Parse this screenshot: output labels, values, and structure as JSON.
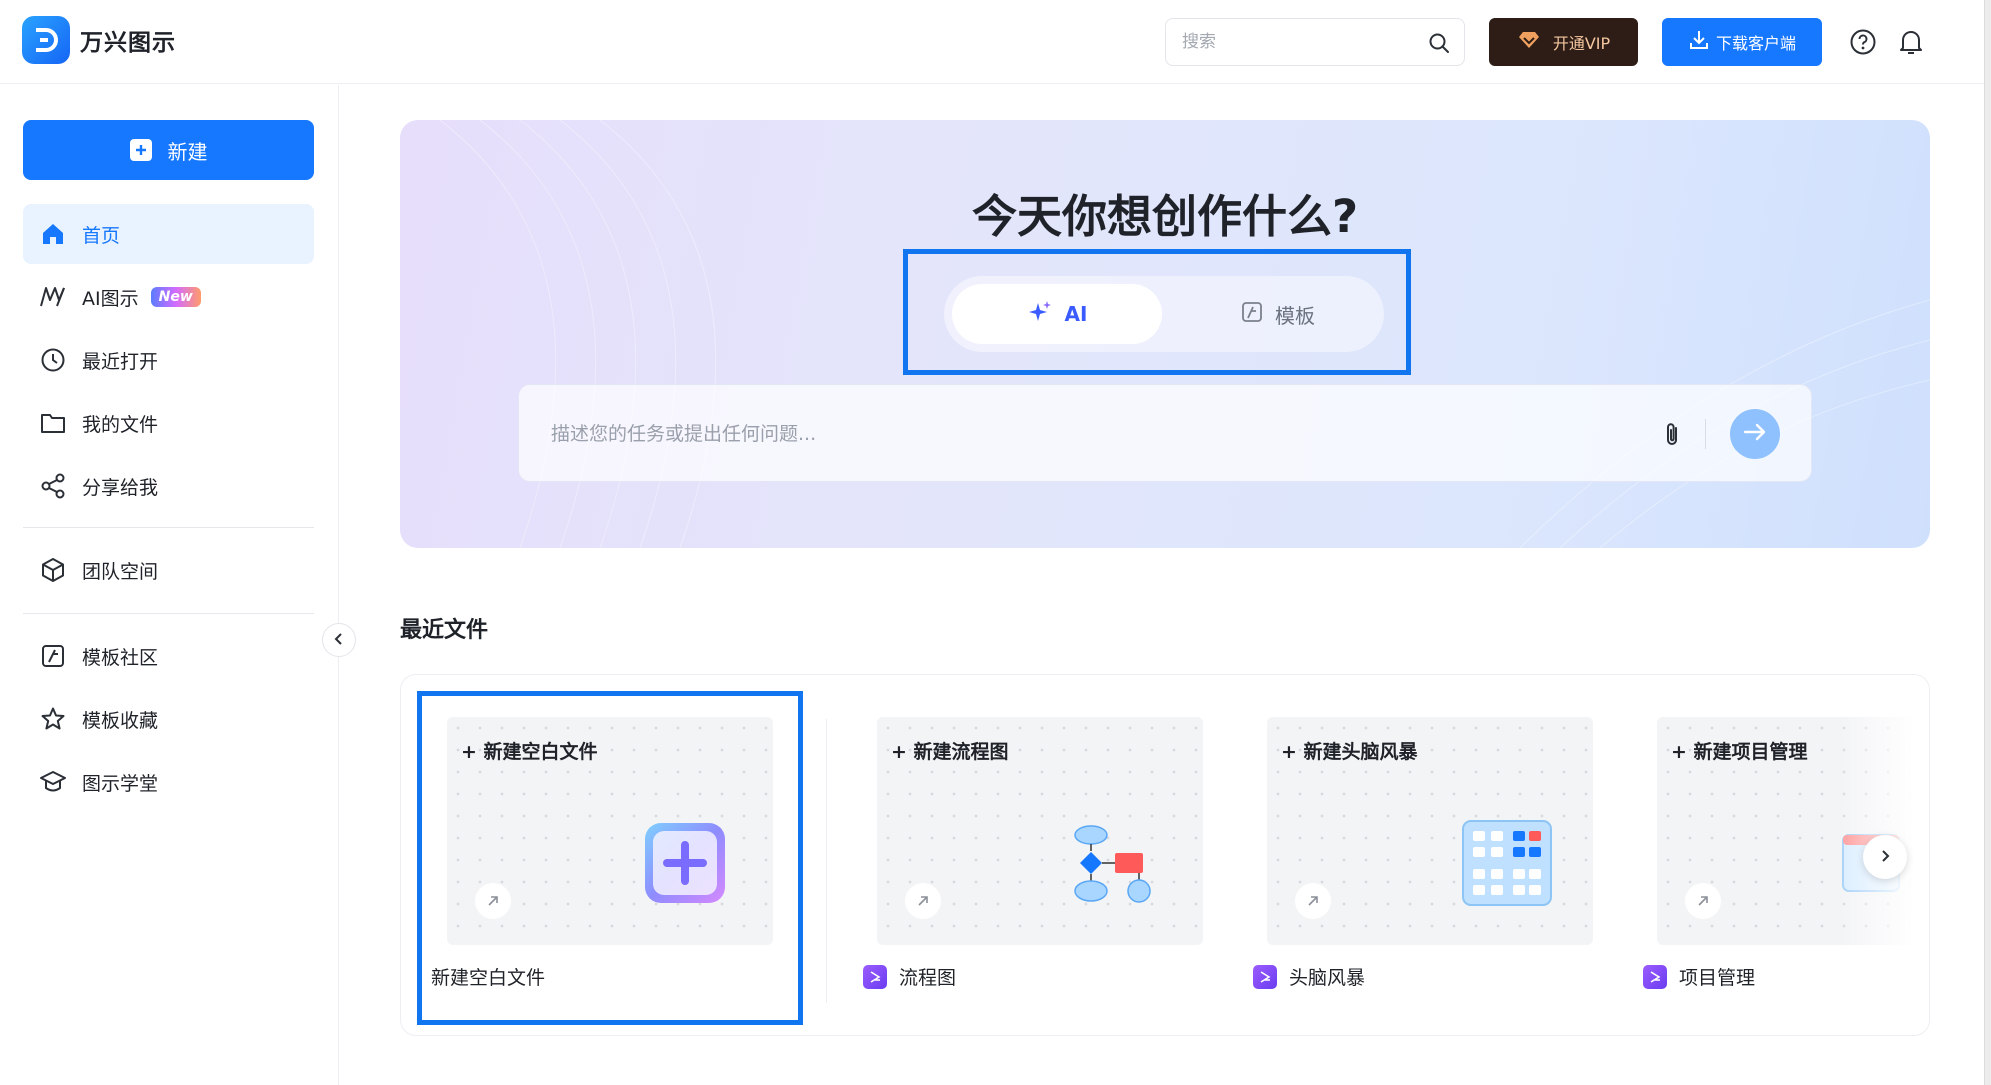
{
  "app": {
    "name": "万兴图示"
  },
  "header": {
    "search_placeholder": "搜索",
    "vip_label": "开通VIP",
    "download_label": "下载客户端"
  },
  "sidebar": {
    "new_label": "新建",
    "items": [
      {
        "label": "首页",
        "icon": "home-icon",
        "active": true
      },
      {
        "label": "AI图示",
        "icon": "ai-diagram-icon",
        "badge": "New"
      },
      {
        "label": "最近打开",
        "icon": "clock-icon"
      },
      {
        "label": "我的文件",
        "icon": "folder-icon"
      },
      {
        "label": "分享给我",
        "icon": "share-icon"
      },
      {
        "label": "团队空间",
        "icon": "team-cube-icon"
      },
      {
        "label": "模板社区",
        "icon": "template-icon"
      },
      {
        "label": "模板收藏",
        "icon": "star-icon"
      },
      {
        "label": "图示学堂",
        "icon": "graduation-cap-icon"
      }
    ]
  },
  "hero": {
    "title": "今天你想创作什么?",
    "modes": [
      {
        "label": "AI",
        "selected": true
      },
      {
        "label": "模板",
        "selected": false
      }
    ],
    "prompt_placeholder": "描述您的任务或提出任何问题..."
  },
  "recent": {
    "title": "最近文件",
    "cards": [
      {
        "thumb_title": "+ 新建空白文件",
        "label": "新建空白文件",
        "has_file_icon": false
      },
      {
        "thumb_title": "+ 新建流程图",
        "label": "流程图",
        "has_file_icon": true
      },
      {
        "thumb_title": "+ 新建头脑风暴",
        "label": "头脑风暴",
        "has_file_icon": true
      },
      {
        "thumb_title": "+ 新建项目管理",
        "label": "项目管理",
        "has_file_icon": true
      }
    ]
  },
  "colors": {
    "accent": "#1677ff",
    "highlight_border": "#1275f0",
    "vip_bg": "#2d1d16"
  }
}
